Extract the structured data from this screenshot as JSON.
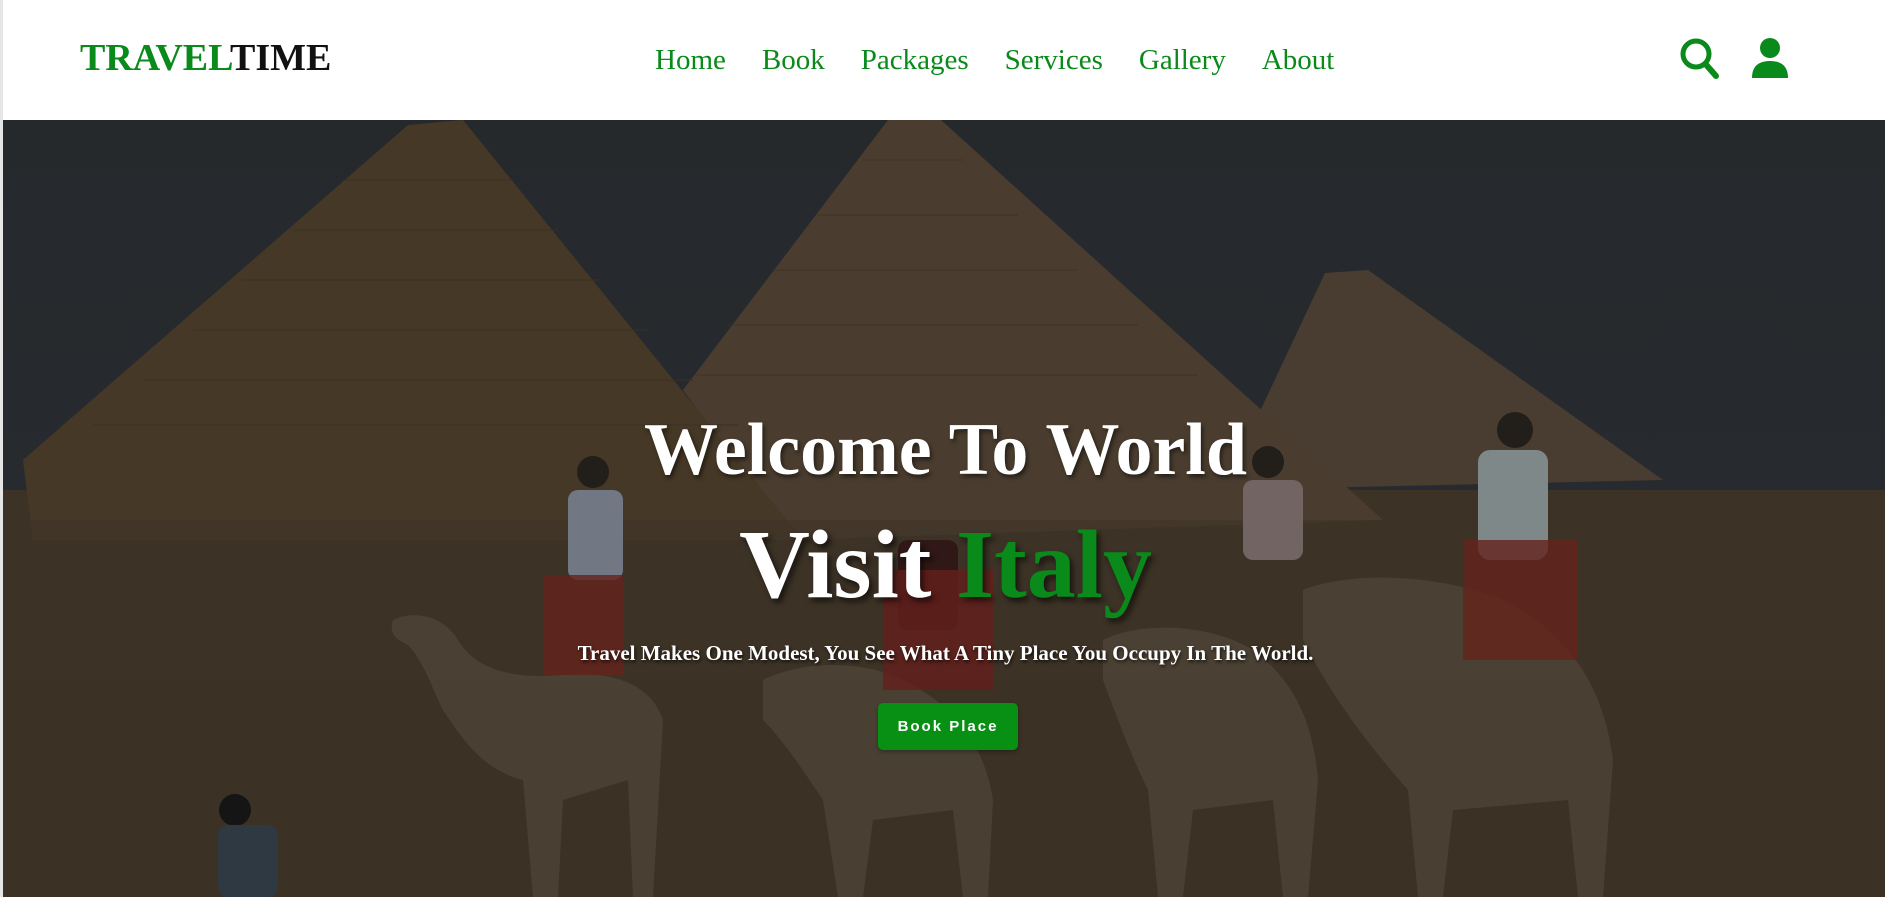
{
  "brand": {
    "part1": "TRAVEL",
    "part2": "TIME",
    "accent_color": "#0a8a1a"
  },
  "nav": {
    "items": [
      {
        "label": "Home"
      },
      {
        "label": "Book"
      },
      {
        "label": "Packages"
      },
      {
        "label": "Services"
      },
      {
        "label": "Gallery"
      },
      {
        "label": "About"
      }
    ]
  },
  "header_icons": {
    "search": "search-icon",
    "user": "user-icon"
  },
  "hero": {
    "heading": "Welcome To World",
    "subheading_prefix": "Visit ",
    "subheading_accent": "Italy",
    "tagline": "Travel Makes One Modest, You See What A Tiny Place You Occupy In The World.",
    "button_label": "Book Place",
    "button_color": "#089014",
    "background_image": "pyramids-and-camel-caravan"
  }
}
